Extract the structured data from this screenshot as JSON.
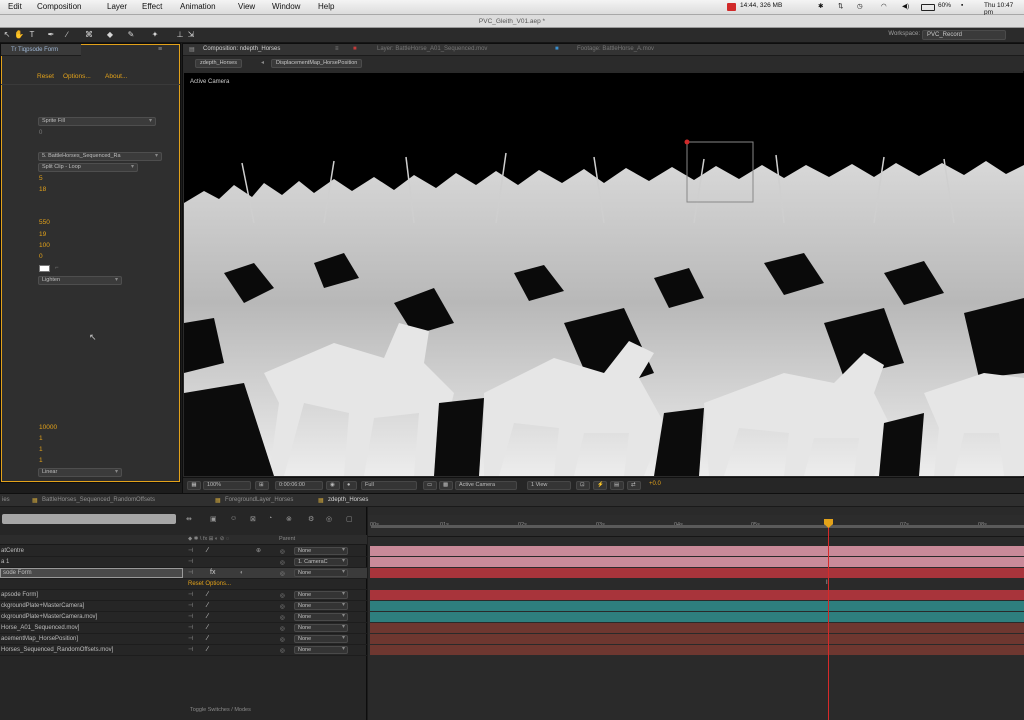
{
  "menubar": {
    "items": [
      "Edit",
      "Composition",
      "Layer",
      "Effect",
      "Animation",
      "View",
      "Window",
      "Help"
    ],
    "status": {
      "memory": "14:44, 326 MB",
      "battery": "60%",
      "clock": "Thu 10:47 pm"
    }
  },
  "window": {
    "title": "PVC_Gleith_V01.aep *"
  },
  "workspace": {
    "label": "Workspace:",
    "value": "PVC_Record"
  },
  "effect_controls": {
    "tab": "Tr Tiqpsode Form",
    "links": [
      "Reset",
      "Options...",
      "About..."
    ],
    "dropdowns": {
      "d1": "Sprite Fill",
      "d2": "5. BattleHorses_Sequenced_Ra",
      "d3": "Split Clip - Loop",
      "d4": "Lighten",
      "d5": "Linear"
    },
    "values": {
      "v0": "0",
      "v1": "5",
      "v2": "18",
      "v3": "550",
      "v4": "19",
      "v5": "100",
      "v6": "0",
      "v7": "10000",
      "v8": "1",
      "v9": "1",
      "v10": "1"
    }
  },
  "composition": {
    "tabs": [
      "Composition: ndepth_Horses",
      "Layer: BattleHorse_A01_Sequenced.mov",
      "Footage: BattleHorse_A.mov"
    ],
    "crumbs": [
      "zdepth_Horses",
      "DisplacementMap_HorsePosition"
    ],
    "viewport_label": "Active Camera",
    "viewer_bar": {
      "zoom": "100%",
      "timecode": "0:00:06:00",
      "resolution": "Full",
      "camera": "Active Camera",
      "views": "1 View",
      "exposure": "+0.0"
    }
  },
  "timeline": {
    "tabs": [
      "BattleHorses_Sequenced_RandomOffsets",
      "ForegroundLayer_Horses",
      "zdepth_Horses"
    ],
    "active_tab_index": 2,
    "parent_header": "Parent",
    "ruler_ticks": [
      "00s",
      "01s",
      "02s",
      "03s",
      "04s",
      "05s",
      "06s",
      "07s",
      "08s"
    ],
    "layers": [
      {
        "name": "atCentre",
        "parent": "None"
      },
      {
        "name": "a 1",
        "parent": "1. CameraC"
      },
      {
        "name": "sode Form",
        "parent": "None"
      },
      {
        "name": "Reset   Options...",
        "parent": ""
      },
      {
        "name": "apsode Form]",
        "parent": "None"
      },
      {
        "name": "ckgroundPlate+MasterCamera]",
        "parent": "None"
      },
      {
        "name": "ckgroundPlate+MasterCamera.mov]",
        "parent": "None"
      },
      {
        "name": "Horse_A01_Sequenced.mov]",
        "parent": "None"
      },
      {
        "name": "acementMap_HorsePosition]",
        "parent": "None"
      },
      {
        "name": "Horses_Sequenced_RandomOffsets.mov]",
        "parent": "None"
      }
    ],
    "footer": "Toggle Switches / Modes",
    "colors": {
      "pink": "#c98a99",
      "red": "#a8343b",
      "teal": "#2e7f7e",
      "brown": "#6e3730",
      "playhead": "#d62a2a",
      "accent": "#e3a21a"
    }
  }
}
